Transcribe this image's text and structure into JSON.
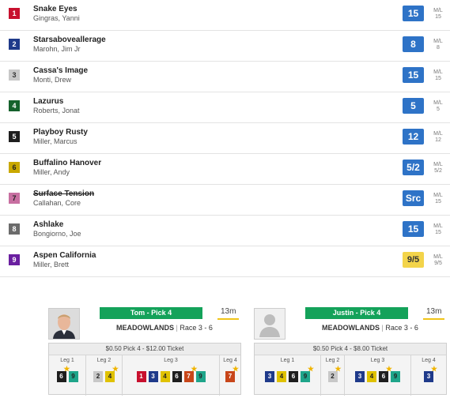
{
  "runners": [
    {
      "pp": "1",
      "name": "Snake Eyes",
      "jockey": "Gingras, Yanni",
      "odds": "15",
      "odds_style": "blue",
      "ml_label": "M/L",
      "ml": "15",
      "scratched": false,
      "pp_bg": "#c8102e",
      "pp_fg": "#ffffff"
    },
    {
      "pp": "2",
      "name": "Starsaboveallerage",
      "jockey": "Marohn, Jim Jr",
      "odds": "8",
      "odds_style": "blue",
      "ml_label": "M/L",
      "ml": "8",
      "scratched": false,
      "pp_bg": "#1f3a8a",
      "pp_fg": "#ffffff"
    },
    {
      "pp": "3",
      "name": "Cassa's Image",
      "jockey": "Monti, Drew",
      "odds": "15",
      "odds_style": "blue",
      "ml_label": "M/L",
      "ml": "15",
      "scratched": false,
      "pp_bg": "#c8c8c8",
      "pp_fg": "#333333"
    },
    {
      "pp": "4",
      "name": "Lazurus",
      "jockey": "Roberts, Jonat",
      "odds": "5",
      "odds_style": "blue",
      "ml_label": "M/L",
      "ml": "5",
      "scratched": false,
      "pp_bg": "#15622c",
      "pp_fg": "#ffffff"
    },
    {
      "pp": "5",
      "name": "Playboy Rusty",
      "jockey": "Miller, Marcus",
      "odds": "12",
      "odds_style": "blue",
      "ml_label": "M/L",
      "ml": "12",
      "scratched": false,
      "pp_bg": "#1e1e1e",
      "pp_fg": "#ffffff"
    },
    {
      "pp": "6",
      "name": "Buffalino Hanover",
      "jockey": "Miller, Andy",
      "odds": "5/2",
      "odds_style": "blue",
      "ml_label": "M/L",
      "ml": "5/2",
      "scratched": false,
      "pp_bg": "#c9a800",
      "pp_fg": "#222222"
    },
    {
      "pp": "7",
      "name": "Surface Tension",
      "jockey": "Callahan, Core",
      "odds": "Src",
      "odds_style": "blue",
      "ml_label": "M/L",
      "ml": "15",
      "scratched": true,
      "pp_bg": "#c86fa1",
      "pp_fg": "#222222"
    },
    {
      "pp": "8",
      "name": "Ashlake",
      "jockey": "Bongiorno, Joe",
      "odds": "15",
      "odds_style": "blue",
      "ml_label": "M/L",
      "ml": "15",
      "scratched": false,
      "pp_bg": "#6b6b6b",
      "pp_fg": "#ffffff"
    },
    {
      "pp": "9",
      "name": "Aspen California",
      "jockey": "Miller, Brett",
      "odds": "9/5",
      "odds_style": "yellow",
      "ml_label": "M/L",
      "ml": "9/5",
      "scratched": false,
      "pp_bg": "#6a1fa0",
      "pp_fg": "#ffffff"
    }
  ],
  "cards": [
    {
      "pick_label": "Tom - Pick 4",
      "time": "13m",
      "track": "MEADOWLANDS",
      "race": "Race 3 - 6",
      "ticket": "$0.50 Pick 4 - $12.00 Ticket",
      "avatar": "photo",
      "legs": [
        {
          "label": "Leg 1",
          "chips": [
            {
              "n": "6",
              "bg": "#1e1e1e",
              "fg": "#ffffff",
              "star": true
            },
            {
              "n": "9",
              "bg": "#1fa58a",
              "fg": "#222222",
              "star": false
            }
          ]
        },
        {
          "label": "Leg 2",
          "chips": [
            {
              "n": "2",
              "bg": "#c8c8c8",
              "fg": "#222222",
              "star": false
            },
            {
              "n": "4",
              "bg": "#e0c200",
              "fg": "#222222",
              "star": true
            }
          ]
        },
        {
          "label": "Leg 3",
          "chips": [
            {
              "n": "1",
              "bg": "#c8102e",
              "fg": "#ffffff",
              "star": false
            },
            {
              "n": "3",
              "bg": "#1f3a8a",
              "fg": "#ffffff",
              "star": false
            },
            {
              "n": "4",
              "bg": "#e0c200",
              "fg": "#222222",
              "star": false
            },
            {
              "n": "6",
              "bg": "#1e1e1e",
              "fg": "#ffffff",
              "star": false
            },
            {
              "n": "7",
              "bg": "#c8461a",
              "fg": "#ffffff",
              "star": true
            },
            {
              "n": "9",
              "bg": "#1fa58a",
              "fg": "#222222",
              "star": false
            }
          ]
        },
        {
          "label": "Leg 4",
          "chips": [
            {
              "n": "7",
              "bg": "#c8461a",
              "fg": "#ffffff",
              "star": true
            }
          ]
        }
      ]
    },
    {
      "pick_label": "Justin - Pick 4",
      "time": "13m",
      "track": "MEADOWLANDS",
      "race": "Race 3 - 6",
      "ticket": "$0.50 Pick 4 - $8.00 Ticket",
      "avatar": "placeholder",
      "legs": [
        {
          "label": "Leg 1",
          "chips": [
            {
              "n": "3",
              "bg": "#1f3a8a",
              "fg": "#ffffff",
              "star": false
            },
            {
              "n": "4",
              "bg": "#e0c200",
              "fg": "#222222",
              "star": false
            },
            {
              "n": "6",
              "bg": "#1e1e1e",
              "fg": "#ffffff",
              "star": false
            },
            {
              "n": "9",
              "bg": "#1fa58a",
              "fg": "#222222",
              "star": true
            }
          ]
        },
        {
          "label": "Leg 2",
          "chips": [
            {
              "n": "2",
              "bg": "#c8c8c8",
              "fg": "#222222",
              "star": true
            }
          ]
        },
        {
          "label": "Leg 3",
          "chips": [
            {
              "n": "3",
              "bg": "#1f3a8a",
              "fg": "#ffffff",
              "star": false
            },
            {
              "n": "4",
              "bg": "#e0c200",
              "fg": "#222222",
              "star": false
            },
            {
              "n": "6",
              "bg": "#1e1e1e",
              "fg": "#ffffff",
              "star": true
            },
            {
              "n": "9",
              "bg": "#1fa58a",
              "fg": "#222222",
              "star": false
            }
          ]
        },
        {
          "label": "Leg 4",
          "chips": [
            {
              "n": "3",
              "bg": "#1f3a8a",
              "fg": "#ffffff",
              "star": true
            }
          ]
        }
      ]
    }
  ]
}
